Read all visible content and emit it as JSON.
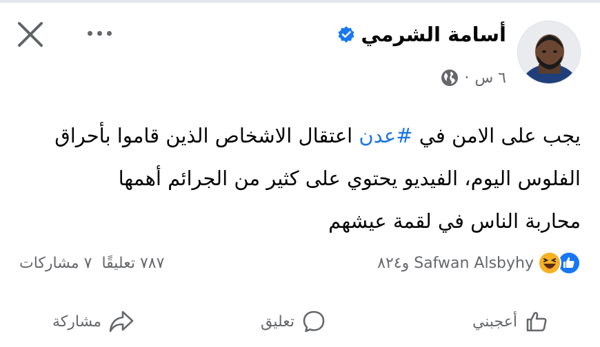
{
  "post": {
    "author_name": "أسامة الشرمي",
    "time": "٦ س",
    "separator": "·",
    "text_line1_before": "يجب على الامن في ",
    "hashtag": "#عدن",
    "text_line1_after": " اعتقال الاشخاص الذين قاموا بأحراق",
    "text_line2": "الفلوس اليوم، الفيديو يحتوي على كثير من الجرائم أهمها",
    "text_line3": "محاربة الناس في لقمة عيشهم"
  },
  "engagement": {
    "reactors": "Safwan Alsbyhy و٨٢٤",
    "comments": "٧٨٧ تعليقًا",
    "shares": "٧ مشاركات",
    "reaction_icons": [
      "like-icon",
      "haha-icon"
    ]
  },
  "actions": {
    "like": "أعجبني",
    "comment": "تعليق",
    "share": "مشاركة"
  },
  "colors": {
    "accent": "#1b74e4",
    "secondary_text": "#65676b",
    "verified": "#1877f2"
  }
}
